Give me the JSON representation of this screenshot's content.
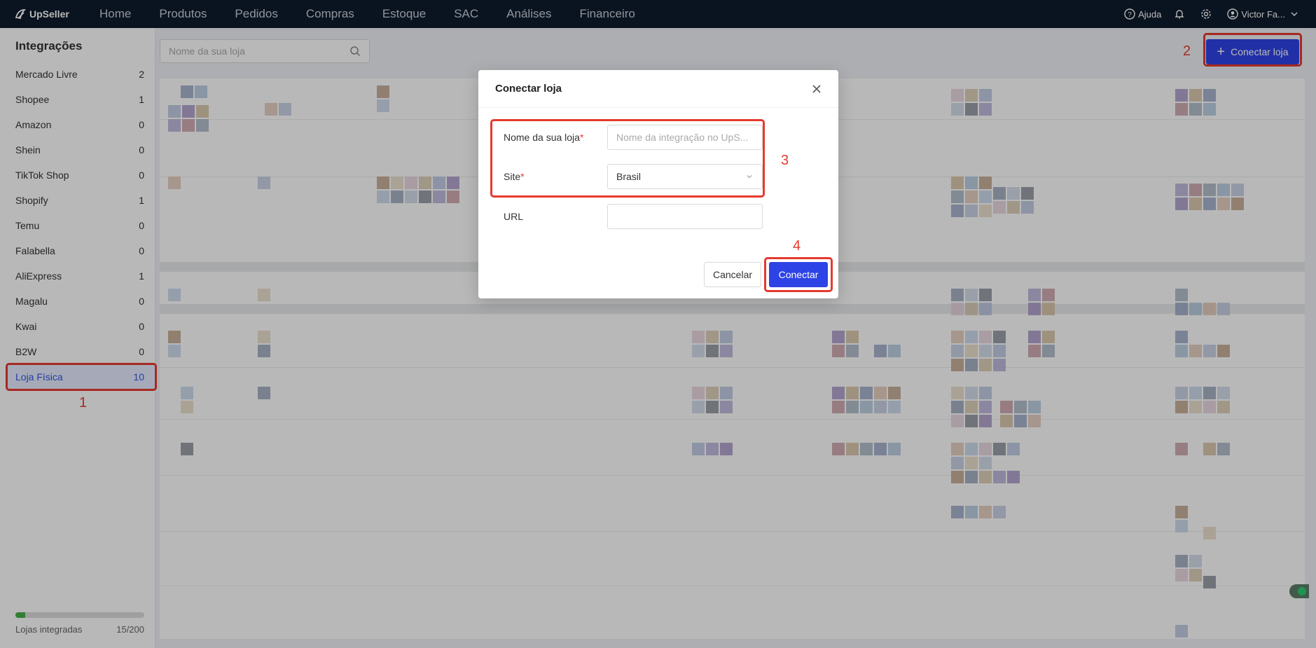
{
  "app": {
    "name": "UpSeller"
  },
  "nav": {
    "items": [
      "Home",
      "Produtos",
      "Pedidos",
      "Compras",
      "Estoque",
      "SAC",
      "Análises",
      "Financeiro"
    ]
  },
  "header_right": {
    "help": "Ajuda",
    "user": "Victor Fa..."
  },
  "sidebar": {
    "title": "Integrações",
    "items": [
      {
        "label": "Mercado Livre",
        "count": "2"
      },
      {
        "label": "Shopee",
        "count": "1"
      },
      {
        "label": "Amazon",
        "count": "0"
      },
      {
        "label": "Shein",
        "count": "0"
      },
      {
        "label": "TikTok Shop",
        "count": "0"
      },
      {
        "label": "Shopify",
        "count": "1"
      },
      {
        "label": "Temu",
        "count": "0"
      },
      {
        "label": "Falabella",
        "count": "0"
      },
      {
        "label": "AliExpress",
        "count": "1"
      },
      {
        "label": "Magalu",
        "count": "0"
      },
      {
        "label": "Kwai",
        "count": "0"
      },
      {
        "label": "B2W",
        "count": "0"
      },
      {
        "label": "Loja Física",
        "count": "10"
      }
    ],
    "active_index": 12,
    "footer_label": "Lojas integradas",
    "footer_value": "15/200",
    "progress_fraction": 0.075
  },
  "main": {
    "search_placeholder": "Nome da sua loja",
    "connect_button": "Conectar loja"
  },
  "modal": {
    "title": "Conectar loja",
    "fields": {
      "name_label": "Nome da sua loja",
      "name_placeholder": "Nome da integração no UpS...",
      "site_label": "Site",
      "site_value": "Brasil",
      "url_label": "URL",
      "url_value": "",
      "required_mark": "*"
    },
    "cancel": "Cancelar",
    "connect": "Conectar"
  },
  "annotations": [
    "1",
    "2",
    "3",
    "4"
  ],
  "colors": {
    "accent": "#2e43e6",
    "annotation": "#e53a2e",
    "topbar": "#0f1b2d",
    "progress": "#43b04a"
  }
}
